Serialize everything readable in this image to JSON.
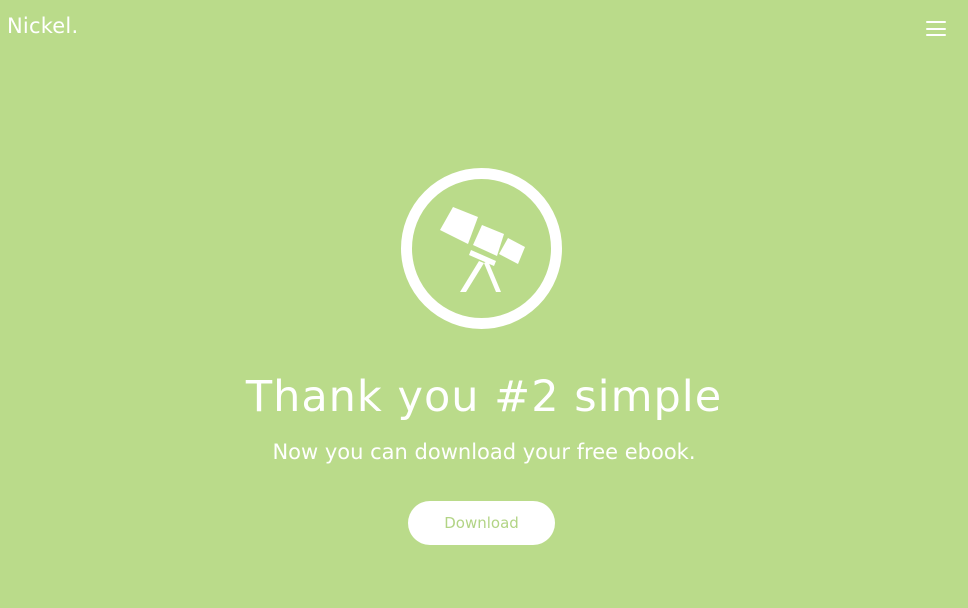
{
  "header": {
    "logo_text": "Nickel.",
    "menu_icon": "hamburger-menu-icon"
  },
  "hero": {
    "icon": "telescope-icon",
    "title": "Thank you #2 simple",
    "subtitle": "Now you can download your free ebook.",
    "download_label": "Download"
  },
  "colors": {
    "background": "#badb8a",
    "foreground": "#ffffff",
    "button_text": "#b2d485"
  }
}
